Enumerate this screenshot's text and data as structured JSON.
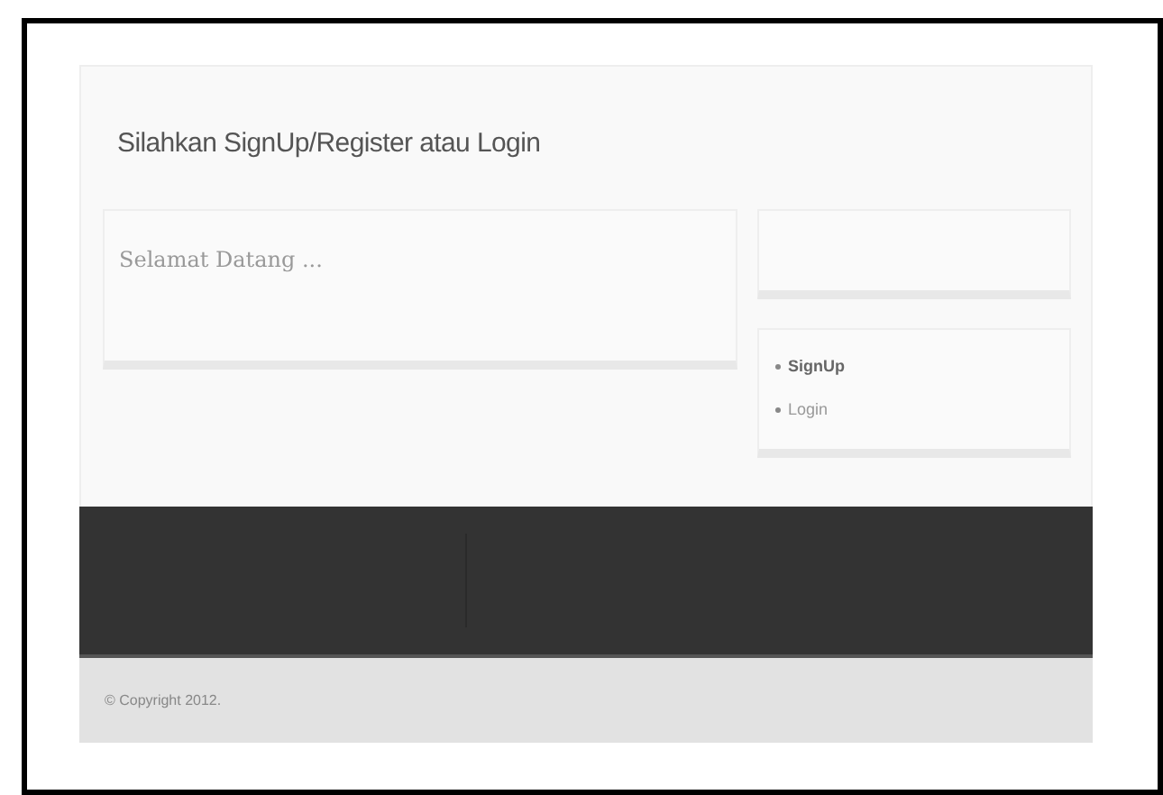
{
  "page": {
    "title": "Silahkan SignUp/Register atau Login"
  },
  "welcome": {
    "text": "Selamat Datang ..."
  },
  "menu": [
    {
      "label": "SignUp",
      "selected": true
    },
    {
      "label": "Login",
      "selected": false
    }
  ],
  "footer": {
    "copyright": "© Copyright 2012."
  }
}
